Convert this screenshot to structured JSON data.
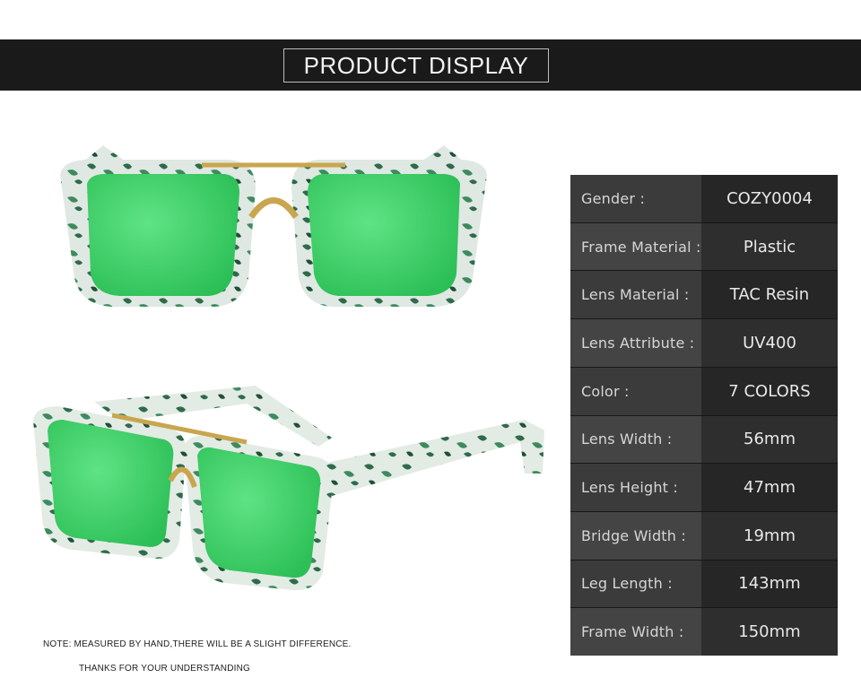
{
  "banner": {
    "title": "PRODUCT DISPLAY"
  },
  "specs": [
    {
      "label": "Gender :",
      "value": "COZY0004"
    },
    {
      "label": "Frame Material :",
      "value": "Plastic"
    },
    {
      "label": "Lens Material :",
      "value": "TAC Resin"
    },
    {
      "label": "Lens Attribute :",
      "value": "UV400"
    },
    {
      "label": "Color :",
      "value": "7 COLORS"
    },
    {
      "label": "Lens Width :",
      "value": "56mm"
    },
    {
      "label": "Lens Height :",
      "value": "47mm"
    },
    {
      "label": "Bridge Width :",
      "value": "19mm"
    },
    {
      "label": "Leg Length :",
      "value": "143mm"
    },
    {
      "label": "Frame Width :",
      "value": "150mm"
    }
  ],
  "note": "NOTE: MEASURED BY HAND,THERE WILL BE A SLIGHT DIFFERENCE.",
  "thanks": "THANKS FOR YOUR UNDERSTANDING",
  "colors": {
    "lens": "#3fd46a",
    "frame_dark": "#2f6b4a",
    "frame_light": "#dfe8e2",
    "bridge": "#c9a64e"
  }
}
